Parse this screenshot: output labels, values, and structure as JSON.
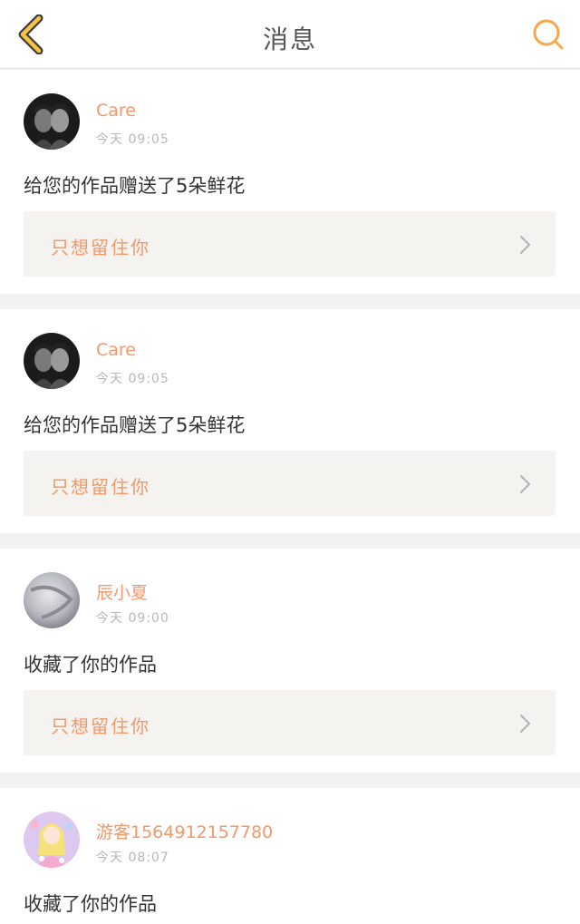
{
  "header": {
    "title": "消息",
    "back_icon": "chevron-left-icon",
    "search_icon": "search-icon",
    "accent": "#f5a84b"
  },
  "notifications": [
    {
      "username": "Care",
      "time": "今天 09:05",
      "message": "给您的作品赠送了5朵鲜花",
      "work_title": "只想留住你",
      "avatar": "dark-photo"
    },
    {
      "username": "Care",
      "time": "今天 09:05",
      "message": "给您的作品赠送了5朵鲜花",
      "work_title": "只想留住你",
      "avatar": "dark-photo"
    },
    {
      "username": "辰小夏",
      "time": "今天 09:00",
      "message": "收藏了你的作品",
      "work_title": "只想留住你",
      "avatar": "grey-photo"
    },
    {
      "username": "游客1564912157780",
      "time": "今天 08:07",
      "message": "收藏了你的作品",
      "avatar": "anime-girl"
    }
  ],
  "colors": {
    "username": "#f0996a",
    "work_title": "#f0996a",
    "work_box_bg": "#f4f3ef"
  }
}
